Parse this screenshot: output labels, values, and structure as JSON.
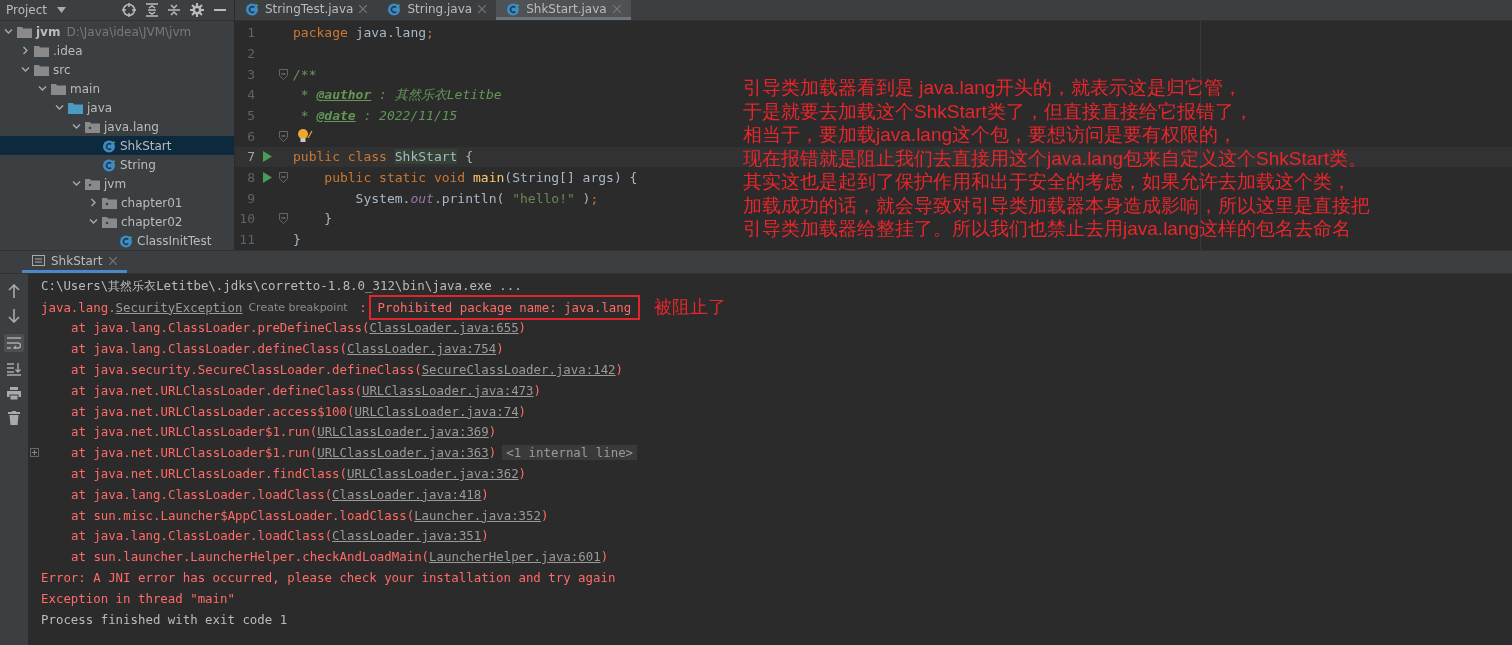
{
  "project_panel": {
    "title": "Project",
    "tree": [
      {
        "label": "jvm",
        "path": "D:\\Java\\idea\\JVM\\jvm",
        "kind": "module",
        "expanded": true,
        "selected": false,
        "children": [
          {
            "label": ".idea",
            "kind": "folder",
            "expanded": false,
            "selected": false
          },
          {
            "label": "src",
            "kind": "folder",
            "expanded": true,
            "selected": false,
            "children": [
              {
                "label": "main",
                "kind": "folder",
                "expanded": true,
                "selected": false,
                "children": [
                  {
                    "label": "java",
                    "kind": "source",
                    "expanded": true,
                    "selected": false,
                    "children": [
                      {
                        "label": "java.lang",
                        "kind": "package",
                        "expanded": true,
                        "selected": false,
                        "children": [
                          {
                            "label": "ShkStart",
                            "kind": "class",
                            "selected": true
                          },
                          {
                            "label": "String",
                            "kind": "class",
                            "selected": false
                          }
                        ]
                      },
                      {
                        "label": "jvm",
                        "kind": "package",
                        "expanded": true,
                        "selected": false,
                        "children": [
                          {
                            "label": "chapter01",
                            "kind": "package",
                            "expanded": false,
                            "selected": false
                          },
                          {
                            "label": "chapter02",
                            "kind": "package",
                            "expanded": true,
                            "selected": false,
                            "children": [
                              {
                                "label": "ClassInitTest",
                                "kind": "class",
                                "selected": false
                              }
                            ]
                          }
                        ]
                      }
                    ]
                  }
                ]
              }
            ]
          }
        ]
      }
    ]
  },
  "editor": {
    "tabs": [
      {
        "label": "StringTest.java",
        "selected": false
      },
      {
        "label": "String.java",
        "selected": false
      },
      {
        "label": "ShkStart.java",
        "selected": true
      }
    ],
    "lines": [
      {
        "number": "1",
        "run": false,
        "fold": false,
        "hint": false,
        "current": false,
        "tokens": [
          {
            "kind": "keyword",
            "text": "package "
          },
          {
            "kind": "plain",
            "text": "java.lang"
          },
          {
            "kind": "keyword",
            "text": ";"
          }
        ]
      },
      {
        "number": "2",
        "run": false,
        "fold": false,
        "hint": false,
        "current": false
      },
      {
        "number": "3",
        "run": false,
        "fold": true,
        "hint": false,
        "current": false,
        "tokens": [
          {
            "kind": "doc",
            "text": "/**"
          }
        ]
      },
      {
        "number": "4",
        "run": false,
        "fold": false,
        "hint": false,
        "current": false,
        "tokens": [
          {
            "kind": "doc",
            "text": " * "
          },
          {
            "kind": "doctag",
            "text": "@author"
          },
          {
            "kind": "doc",
            "text": " : 其然乐衣Letitbe"
          }
        ]
      },
      {
        "number": "5",
        "run": false,
        "fold": false,
        "hint": false,
        "current": false,
        "tokens": [
          {
            "kind": "doc",
            "text": " * "
          },
          {
            "kind": "doctag",
            "text": "@date"
          },
          {
            "kind": "doc",
            "text": " : 2022/11/15"
          }
        ]
      },
      {
        "number": "6",
        "run": false,
        "fold": true,
        "hint": true,
        "current": false
      },
      {
        "number": "7",
        "run": true,
        "fold": false,
        "hint": false,
        "current": true,
        "tokens": [
          {
            "kind": "keyword",
            "text": "public class "
          },
          {
            "kind": "highlight",
            "text": "ShkStart"
          },
          {
            "kind": "plain",
            "text": " {"
          }
        ]
      },
      {
        "number": "8",
        "run": true,
        "fold": true,
        "hint": false,
        "current": false,
        "tokens": [
          {
            "kind": "keyword",
            "text": "    public static void "
          },
          {
            "kind": "method",
            "text": "main"
          },
          {
            "kind": "plain",
            "text": "(String[] args) {"
          }
        ]
      },
      {
        "number": "9",
        "run": false,
        "fold": false,
        "hint": false,
        "current": false,
        "tokens": [
          {
            "kind": "plain",
            "text": "        System."
          },
          {
            "kind": "field",
            "text": "out"
          },
          {
            "kind": "plain",
            "text": ".println( "
          },
          {
            "kind": "string",
            "text": "\"hello!\""
          },
          {
            "kind": "plain",
            "text": " )"
          },
          {
            "kind": "keyword",
            "text": ";"
          }
        ]
      },
      {
        "number": "10",
        "run": false,
        "fold": true,
        "hint": false,
        "current": false,
        "tokens": [
          {
            "kind": "plain",
            "text": "    }"
          }
        ]
      },
      {
        "number": "11",
        "run": false,
        "fold": false,
        "hint": false,
        "current": false,
        "tokens": [
          {
            "kind": "plain",
            "text": "}"
          }
        ]
      }
    ]
  },
  "annotation": [
    "引导类加载器看到是 java.lang开头的，就表示这是归它管，",
    "于是就要去加载这个ShkStart类了，但直接直接给它报错了，",
    "相当于，要加载java.lang这个包，要想访问是要有权限的，",
    "现在报错就是阻止我们去直接用这个java.lang包来自定义这个ShkStart类。",
    "其实这也是起到了保护作用和出于安全的考虑，如果允许去加载这个类，",
    "加载成功的话，就会导致对引导类加载器本身造成影响，所以这里是直接把",
    "引导类加载器给整挂了。所以我们也禁止去用java.lang这样的包名去命名"
  ],
  "run_panel": {
    "tab": "ShkStart",
    "lines": [
      {
        "kind": "command",
        "fold": false,
        "segments": [
          {
            "kind": "text",
            "text": "C:\\Users\\其然乐衣Letitbe\\.jdks\\corretto-1.8.0_312\\bin\\java.exe ..."
          }
        ]
      },
      {
        "kind": "error",
        "fold": false,
        "segments": [
          {
            "kind": "text",
            "text": "java.lang."
          },
          {
            "kind": "link",
            "text": "SecurityException"
          },
          {
            "kind": "hint",
            "text": "Create breakpoint"
          },
          {
            "kind": "text",
            "text": " :"
          },
          {
            "kind": "boxed",
            "text": "Prohibited package name: java.lang"
          },
          {
            "kind": "note",
            "text": "被阻止了"
          }
        ]
      },
      {
        "kind": "trace",
        "fold": false,
        "segments": [
          {
            "kind": "text",
            "text": "at java.lang.ClassLoader.preDefineClass("
          },
          {
            "kind": "link",
            "text": "ClassLoader.java:655"
          },
          {
            "kind": "text",
            "text": ")"
          }
        ]
      },
      {
        "kind": "trace",
        "fold": false,
        "segments": [
          {
            "kind": "text",
            "text": "at java.lang.ClassLoader.defineClass("
          },
          {
            "kind": "link",
            "text": "ClassLoader.java:754"
          },
          {
            "kind": "text",
            "text": ")"
          }
        ]
      },
      {
        "kind": "trace",
        "fold": false,
        "segments": [
          {
            "kind": "text",
            "text": "at java.security.SecureClassLoader.defineClass("
          },
          {
            "kind": "link",
            "text": "SecureClassLoader.java:142"
          },
          {
            "kind": "text",
            "text": ")"
          }
        ]
      },
      {
        "kind": "trace",
        "fold": false,
        "segments": [
          {
            "kind": "text",
            "text": "at java.net.URLClassLoader.defineClass("
          },
          {
            "kind": "link",
            "text": "URLClassLoader.java:473"
          },
          {
            "kind": "text",
            "text": ")"
          }
        ]
      },
      {
        "kind": "trace",
        "fold": false,
        "segments": [
          {
            "kind": "text",
            "text": "at java.net.URLClassLoader.access$100("
          },
          {
            "kind": "link",
            "text": "URLClassLoader.java:74"
          },
          {
            "kind": "text",
            "text": ")"
          }
        ]
      },
      {
        "kind": "trace",
        "fold": false,
        "segments": [
          {
            "kind": "text",
            "text": "at java.net.URLClassLoader$1.run("
          },
          {
            "kind": "link",
            "text": "URLClassLoader.java:369"
          },
          {
            "kind": "text",
            "text": ")"
          }
        ]
      },
      {
        "kind": "trace",
        "fold": true,
        "segments": [
          {
            "kind": "text",
            "text": "at java.net.URLClassLoader$1.run("
          },
          {
            "kind": "link",
            "text": "URLClassLoader.java:363"
          },
          {
            "kind": "text",
            "text": ")"
          },
          {
            "kind": "collapsed",
            "text": "<1 internal line>"
          }
        ]
      },
      {
        "kind": "trace",
        "fold": false,
        "segments": [
          {
            "kind": "text",
            "text": "at java.net.URLClassLoader.findClass("
          },
          {
            "kind": "link",
            "text": "URLClassLoader.java:362"
          },
          {
            "kind": "text",
            "text": ")"
          }
        ]
      },
      {
        "kind": "trace",
        "fold": false,
        "segments": [
          {
            "kind": "text",
            "text": "at java.lang.ClassLoader.loadClass("
          },
          {
            "kind": "link",
            "text": "ClassLoader.java:418"
          },
          {
            "kind": "text",
            "text": ")"
          }
        ]
      },
      {
        "kind": "trace",
        "fold": false,
        "segments": [
          {
            "kind": "text",
            "text": "at sun.misc.Launcher$AppClassLoader.loadClass("
          },
          {
            "kind": "link",
            "text": "Launcher.java:352"
          },
          {
            "kind": "text",
            "text": ")"
          }
        ]
      },
      {
        "kind": "trace",
        "fold": false,
        "segments": [
          {
            "kind": "text",
            "text": "at java.lang.ClassLoader.loadClass("
          },
          {
            "kind": "link",
            "text": "ClassLoader.java:351"
          },
          {
            "kind": "text",
            "text": ")"
          }
        ]
      },
      {
        "kind": "trace",
        "fold": false,
        "segments": [
          {
            "kind": "text",
            "text": "at sun.launcher.LauncherHelper.checkAndLoadMain("
          },
          {
            "kind": "link",
            "text": "LauncherHelper.java:601"
          },
          {
            "kind": "text",
            "text": ")"
          }
        ]
      },
      {
        "kind": "error",
        "fold": false,
        "segments": [
          {
            "kind": "text",
            "text": "Error: A JNI error has occurred, please check your installation and try again"
          }
        ]
      },
      {
        "kind": "error",
        "fold": false,
        "segments": [
          {
            "kind": "text",
            "text": "Exception in thread \"main\""
          }
        ]
      },
      {
        "kind": "info",
        "fold": false,
        "segments": [
          {
            "kind": "text",
            "text": "Process finished with exit code 1"
          }
        ]
      }
    ]
  }
}
